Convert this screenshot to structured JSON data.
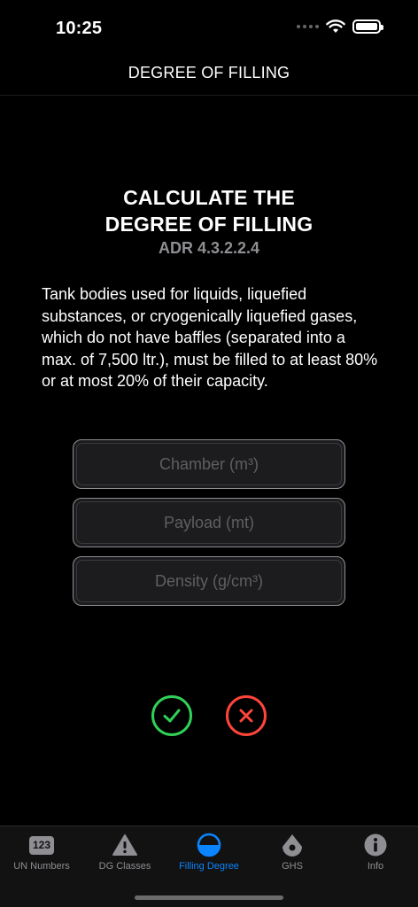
{
  "status": {
    "time": "10:25"
  },
  "nav": {
    "title": "DEGREE OF FILLING"
  },
  "headline": {
    "line1": "CALCULATE THE",
    "line2": "DEGREE OF FILLING",
    "reference": "ADR 4.3.2.2.4"
  },
  "description": "Tank bodies used for liquids, liquefied substances, or cryogenically liquefied gases, which do not have baffles (separated into a max. of 7,500 ltr.), must be filled to at least 80% or at most 20% of their capacity.",
  "fields": [
    {
      "placeholder": "Chamber (m³)",
      "value": ""
    },
    {
      "placeholder": "Payload (mt)",
      "value": ""
    },
    {
      "placeholder": "Density (g/cm³)",
      "value": ""
    }
  ],
  "actions": {
    "confirm_icon": "checkmark-circle-icon",
    "cancel_icon": "x-circle-icon",
    "confirm_color": "#30d158",
    "cancel_color": "#ff453a"
  },
  "tabs": [
    {
      "label": "UN Numbers",
      "icon": "un-numbers-badge-icon",
      "badge": "123",
      "active": false
    },
    {
      "label": "DG Classes",
      "icon": "warning-triangle-icon",
      "active": false
    },
    {
      "label": "Filling Degree",
      "icon": "half-filled-circle-icon",
      "active": true
    },
    {
      "label": "GHS",
      "icon": "drop-icon",
      "active": false
    },
    {
      "label": "Info",
      "icon": "info-circle-icon",
      "active": false
    }
  ],
  "colors": {
    "background": "#000000",
    "accent": "#0a84ff",
    "muted": "#8e8e93"
  }
}
